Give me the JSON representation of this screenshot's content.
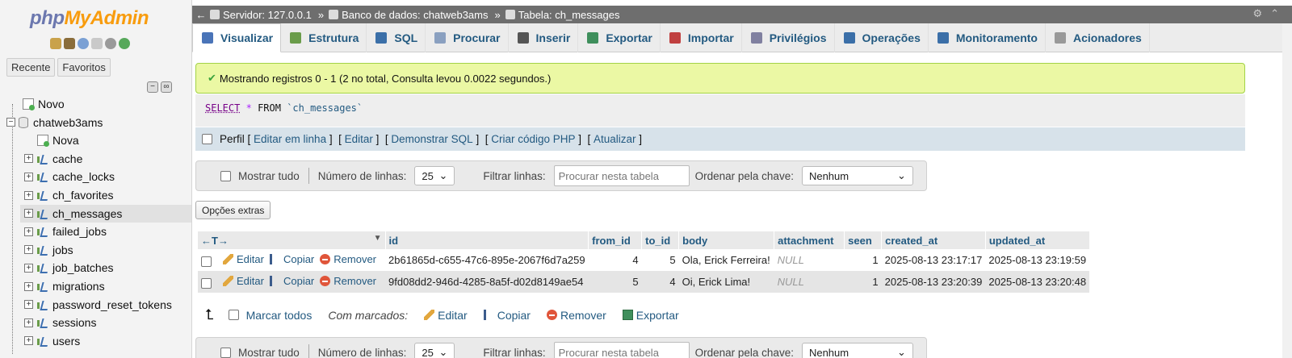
{
  "sidebar": {
    "logo": {
      "part1": "php",
      "part2": "MyAdmin"
    },
    "tabs": [
      "Recente",
      "Favoritos"
    ],
    "tree": [
      {
        "label": "Novo",
        "type": "new"
      },
      {
        "label": "chatweb3ams",
        "type": "db"
      },
      {
        "label": "Nova",
        "type": "new-table"
      },
      {
        "label": "cache",
        "type": "table"
      },
      {
        "label": "cache_locks",
        "type": "table"
      },
      {
        "label": "ch_favorites",
        "type": "table"
      },
      {
        "label": "ch_messages",
        "type": "table",
        "selected": true
      },
      {
        "label": "failed_jobs",
        "type": "table"
      },
      {
        "label": "jobs",
        "type": "table"
      },
      {
        "label": "job_batches",
        "type": "table"
      },
      {
        "label": "migrations",
        "type": "table"
      },
      {
        "label": "password_reset_tokens",
        "type": "table"
      },
      {
        "label": "sessions",
        "type": "table"
      },
      {
        "label": "users",
        "type": "table"
      }
    ]
  },
  "breadcrumb": {
    "server": "Servidor: 127.0.0.1",
    "database": "Banco de dados: chatweb3ams",
    "table": "Tabela: ch_messages",
    "separator": "»"
  },
  "menu": [
    "Visualizar",
    "Estrutura",
    "SQL",
    "Procurar",
    "Inserir",
    "Exportar",
    "Importar",
    "Privilégios",
    "Operações",
    "Monitoramento",
    "Acionadores"
  ],
  "success_message": "Mostrando registros 0 - 1 (2 no total, Consulta levou 0.0022 segundos.)",
  "sql": {
    "kw": "SELECT",
    "star": "*",
    "from": "FROM",
    "table": "`ch_messages`"
  },
  "profile": {
    "label": "Perfil",
    "links": [
      "Editar em linha",
      "Editar",
      "Demonstrar SQL",
      "Criar código PHP",
      "Atualizar"
    ]
  },
  "nav": {
    "show_all": "Mostrar tudo",
    "rows_label": "Número de linhas:",
    "rows_value": "25",
    "filter_label": "Filtrar linhas:",
    "filter_placeholder": "Procurar nesta tabela",
    "sort_label": "Ordenar pela chave:",
    "sort_value": "Nenhum"
  },
  "extra_options": "Opções extras",
  "table": {
    "columns": [
      "id",
      "from_id",
      "to_id",
      "body",
      "attachment",
      "seen",
      "created_at",
      "updated_at"
    ],
    "actions": {
      "edit": "Editar",
      "copy": "Copiar",
      "delete": "Remover"
    },
    "rows": [
      [
        "2b61865d-c655-47c6-895e-2067f6d7a259",
        "4",
        "5",
        "Ola, Erick Ferreira!",
        "NULL",
        "1",
        "2025-08-13 23:17:17",
        "2025-08-13 23:19:59"
      ],
      [
        "9fd08dd2-946d-4285-8a5f-d02d8149ae54",
        "5",
        "4",
        "Oi, Erick Lima!",
        "NULL",
        "1",
        "2025-08-13 23:20:39",
        "2025-08-13 23:20:48"
      ]
    ]
  },
  "bulk": {
    "check_all": "Marcar todos",
    "with_selected": "Com marcados:",
    "edit": "Editar",
    "copy": "Copiar",
    "delete": "Remover",
    "export": "Exportar"
  }
}
